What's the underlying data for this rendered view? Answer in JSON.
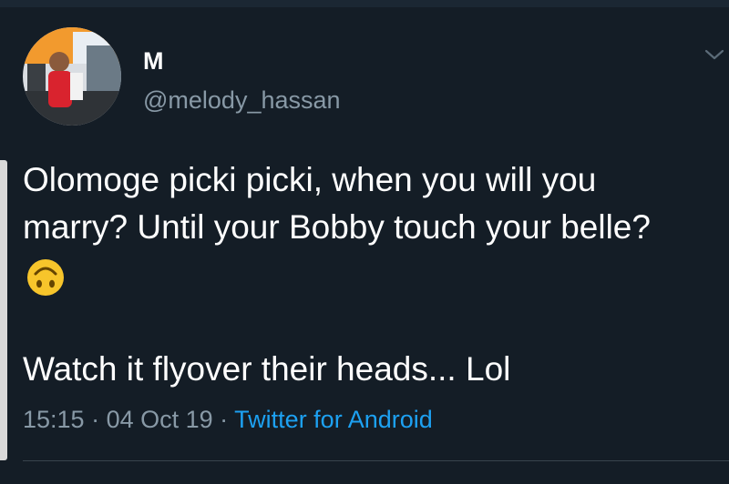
{
  "tweet": {
    "author": {
      "display_name": "M",
      "handle": "@melody_hassan",
      "avatar_icon": "profile-photo-avatar"
    },
    "text_lines": [
      "Olomoge picki picki, when you will you",
      "marry? Until your Bobby touch your belle?"
    ],
    "emoji": "upside-down-face",
    "text_line_2": "Watch it flyover their heads... Lol",
    "meta": {
      "time": "15:15",
      "sep1": " · ",
      "date": "04 Oct 19",
      "sep2": " · ",
      "source": "Twitter for Android"
    }
  },
  "colors": {
    "background": "#141d26",
    "text": "#ffffff",
    "secondary_text": "#8899a6",
    "link": "#1da1f2",
    "emoji_yellow": "#f7c52b"
  }
}
